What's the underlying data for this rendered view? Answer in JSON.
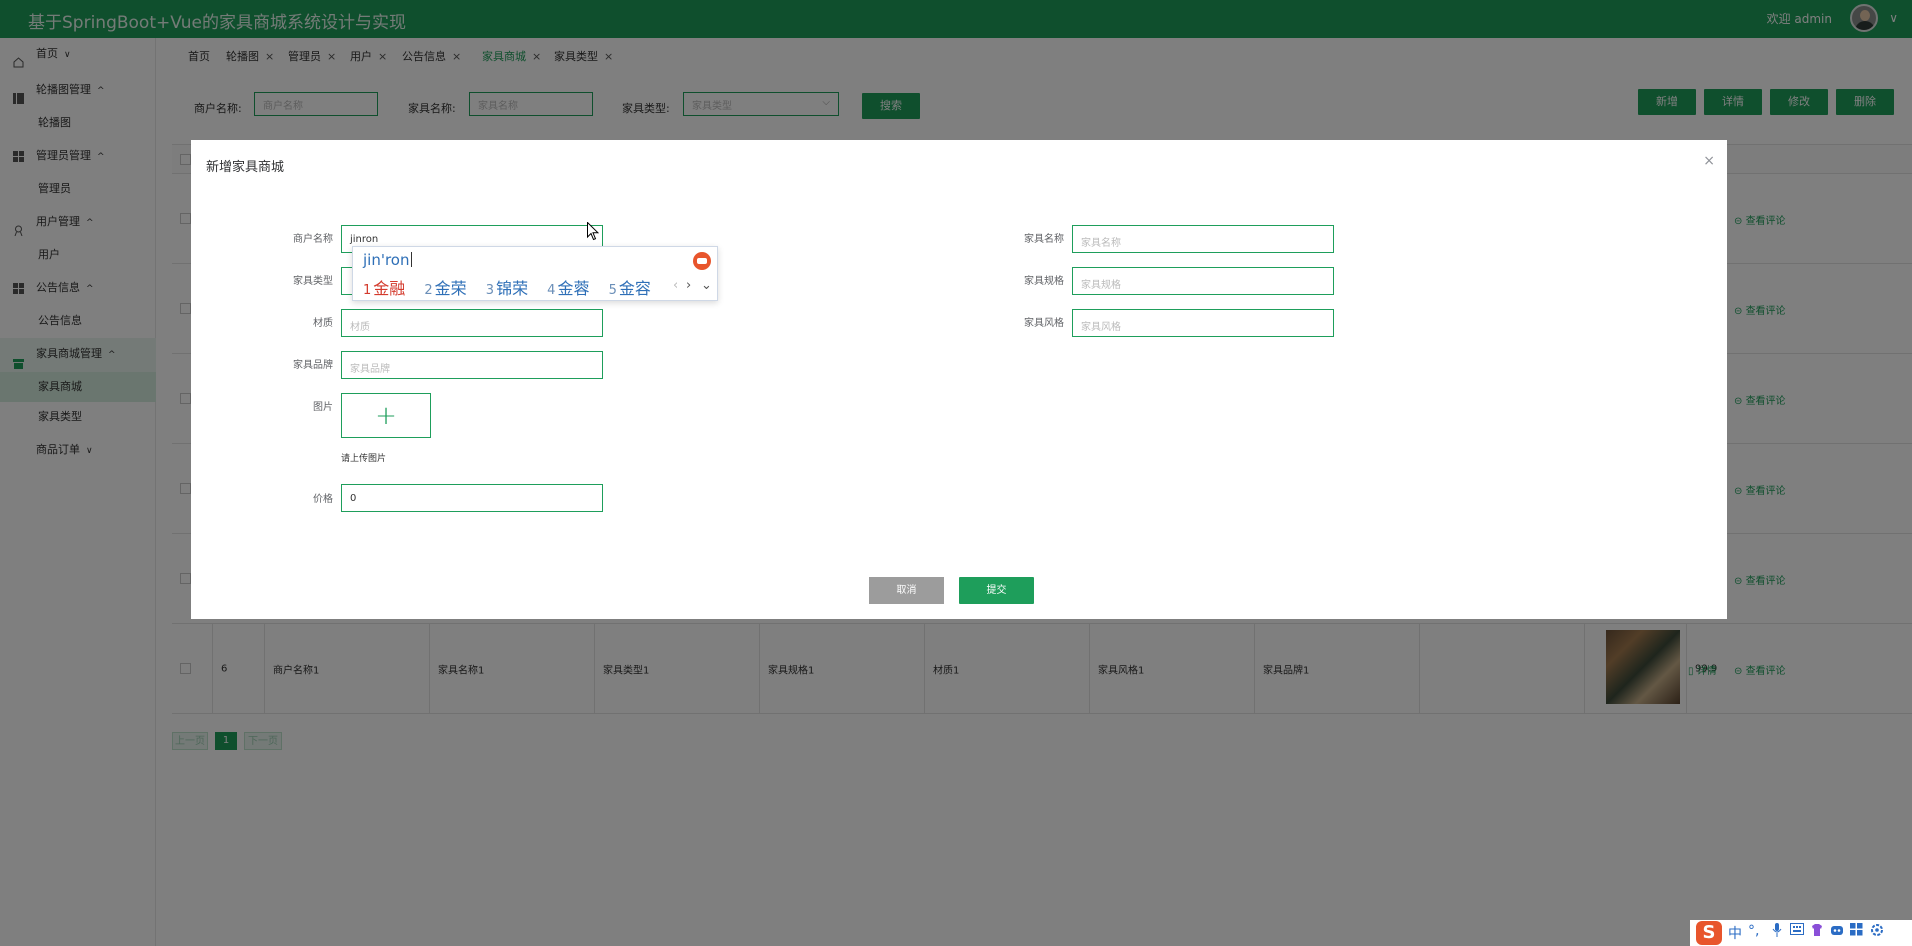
{
  "app": {
    "title": "基于SpringBoot+Vue的家具商城系统设计与实现",
    "welcome": "欢迎 admin",
    "caret": "∨"
  },
  "sidebar": {
    "items": [
      {
        "label": "首页",
        "arrow": "∨"
      },
      {
        "label": "轮播图管理",
        "arrow": "^"
      },
      {
        "label": "轮播图"
      },
      {
        "label": "管理员管理",
        "arrow": "^"
      },
      {
        "label": "管理员"
      },
      {
        "label": "用户管理",
        "arrow": "^"
      },
      {
        "label": "用户"
      },
      {
        "label": "公告信息",
        "arrow": "^"
      },
      {
        "label": "公告信息"
      },
      {
        "label": "家具商城管理",
        "arrow": "^"
      },
      {
        "label": "家具商城"
      },
      {
        "label": "家具类型"
      },
      {
        "label": "商品订单",
        "arrow": "∨"
      }
    ]
  },
  "tabs": [
    {
      "label": "首页",
      "close": ""
    },
    {
      "label": "轮播图",
      "close": "×"
    },
    {
      "label": "管理员",
      "close": "×"
    },
    {
      "label": "用户",
      "close": "×"
    },
    {
      "label": "公告信息",
      "close": "×"
    },
    {
      "label": "家具商城",
      "close": "×"
    },
    {
      "label": "家具类型",
      "close": "×"
    }
  ],
  "search": {
    "merchant_label": "商户名称:",
    "merchant_placeholder": "商户名称",
    "furniture_label": "家具名称:",
    "furniture_placeholder": "家具名称",
    "type_label": "家具类型:",
    "type_placeholder": "家具类型",
    "search_button": "搜索",
    "dropdown_caret": "⌵"
  },
  "toolbar": {
    "add": "新增",
    "detail": "详情",
    "edit": "修改",
    "delete": "删除"
  },
  "table": {
    "review_link": "查看评论",
    "detail_link": "详情",
    "last_row": {
      "index": "6",
      "merchant": "商户名称1",
      "name": "家具名称1",
      "type": "家具类型1",
      "spec": "家具规格1",
      "material": "材质1",
      "style": "家具风格1",
      "brand": "家具品牌1",
      "price": "99.9"
    }
  },
  "pager": {
    "prev": "上一页",
    "current": "1",
    "next": "下一页"
  },
  "dialog": {
    "title": "新增家具商城",
    "close": "×",
    "merchant_label": "商户名称",
    "merchant_value": "jinron",
    "type_label": "家具类型",
    "material_label": "材质",
    "material_placeholder": "材质",
    "brand_label": "家具品牌",
    "brand_placeholder": "家具品牌",
    "image_label": "图片",
    "upload_plus": "+",
    "upload_hint": "请上传图片",
    "price_label": "价格",
    "price_value": "0",
    "name_label": "家具名称",
    "name_placeholder": "家具名称",
    "spec_label": "家具规格",
    "spec_placeholder": "家具规格",
    "style_label": "家具风格",
    "style_placeholder": "家具风格",
    "cancel": "取消",
    "submit": "提交"
  },
  "ime": {
    "pinyin": "jin'ron",
    "candidates": [
      {
        "n": "1",
        "text": "金融"
      },
      {
        "n": "2",
        "text": "金荣"
      },
      {
        "n": "3",
        "text": "锦荣"
      },
      {
        "n": "4",
        "text": "金蓉"
      },
      {
        "n": "5",
        "text": "金容"
      }
    ],
    "prev": "‹",
    "next": "›",
    "expand": "⌄"
  },
  "tray": {
    "logo": "S",
    "lang": "中",
    "punct": "°,"
  },
  "colors": {
    "accent": "#1e9e5b",
    "overlay": "rgba(0,0,0,0.5)"
  }
}
